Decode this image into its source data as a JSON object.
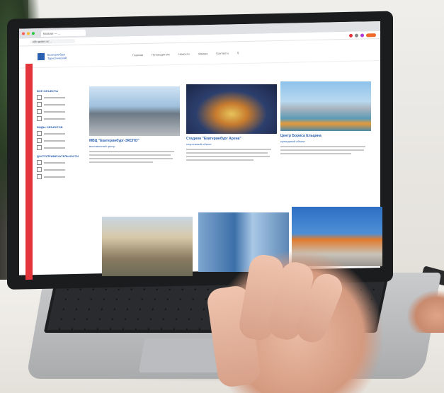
{
  "browser": {
    "tab_label": "Каталог — ...",
    "url": "ekb-guide.ru/..."
  },
  "site": {
    "logo_text": "Екатеринбург Туристический",
    "nav": [
      "Главная",
      "Путеводитель",
      "Новости",
      "Афиша",
      "Контакты"
    ]
  },
  "sidebar": {
    "filters": [
      {
        "title": "ВСЕ ОБЪЕКТЫ",
        "items": 4
      },
      {
        "title": "ВИДЫ ОБЪЕКТОВ",
        "items": 3
      },
      {
        "title": "ДОСТОПРИМЕЧАТЕЛЬНОСТИ",
        "items": 3
      }
    ]
  },
  "cards": [
    {
      "title": "МВЦ \"Екатеринбург-ЭКСПО\"",
      "subtitle": "выставочный центр",
      "image": "expo-pavilion"
    },
    {
      "title": "Стадион \"Екатеринбург Арена\"",
      "subtitle": "спортивный объект",
      "image": "stadium-night"
    },
    {
      "title": "Центр Бориса Ельцина",
      "subtitle": "культурный объект",
      "image": "city-river"
    },
    {
      "title": "",
      "subtitle": "",
      "image": "historic-building"
    },
    {
      "title": "",
      "subtitle": "",
      "image": "glass-tower"
    },
    {
      "title": "",
      "subtitle": "",
      "image": "circus-dome"
    }
  ],
  "colors": {
    "accent_red": "#e3353b",
    "link_blue": "#2b5fb0"
  }
}
